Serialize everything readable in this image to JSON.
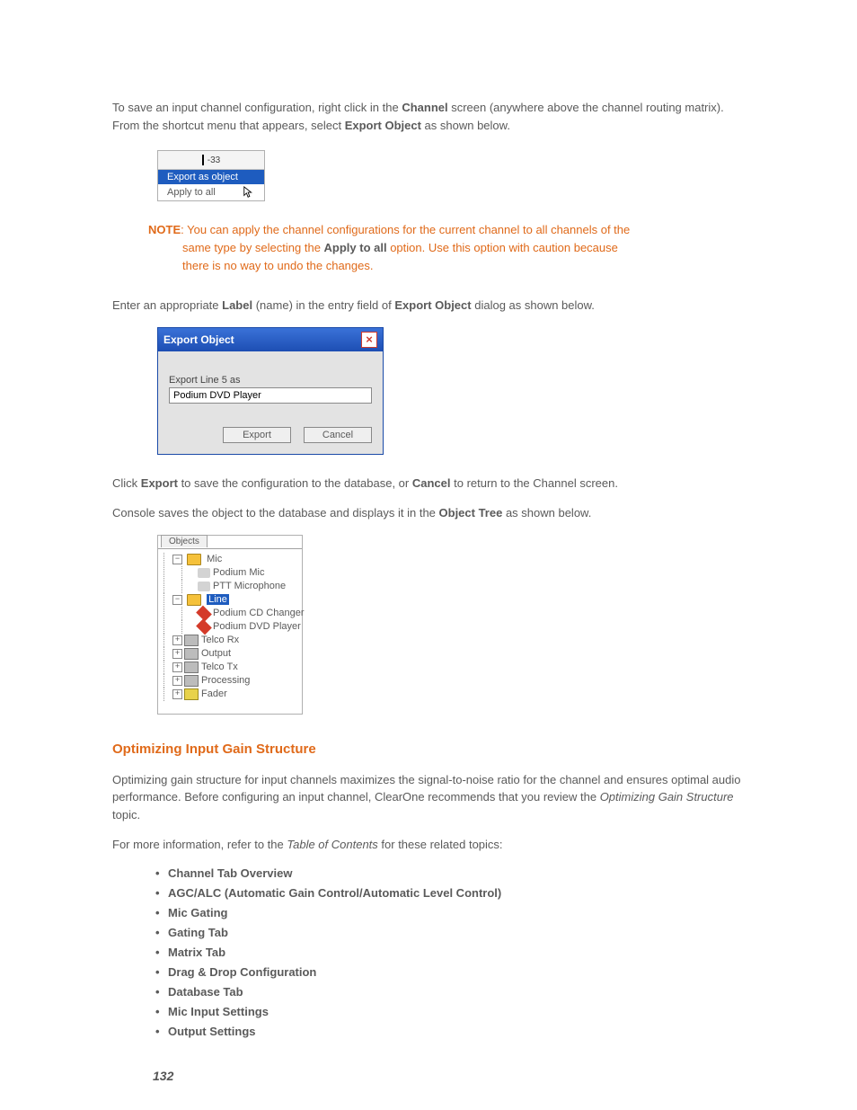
{
  "para1": {
    "pre": "To save an input channel configuration, right click in the ",
    "bold1": "Channel",
    "mid": " screen (anywhere above the channel routing matrix). From the shortcut menu that appears, select ",
    "bold2": "Export Object",
    "post": " as shown below."
  },
  "ctxmenu": {
    "topval": "-33",
    "item1": "Export as object",
    "item2": "Apply to all"
  },
  "note": {
    "label": "NOTE",
    "l1a": ": You can apply the channel configurations for the current channel to all channels of the ",
    "l2a": "same type by selecting the ",
    "l2bold": "Apply to all",
    "l2b": " option. Use this option with caution because ",
    "l3": "there is no way to undo the changes."
  },
  "para2": {
    "pre": "Enter an appropriate ",
    "b1": "Label",
    "mid": " (name) in the entry field of ",
    "b2": "Export Object",
    "post": " dialog as shown below."
  },
  "dialog": {
    "title": "Export Object",
    "label": "Export Line 5 as",
    "value": "Podium DVD Player",
    "export": "Export",
    "cancel": "Cancel"
  },
  "para3": {
    "pre": "Click ",
    "b1": "Export",
    "mid": " to save the configuration to the database, or ",
    "b2": "Cancel",
    "post": " to return to the Channel screen."
  },
  "para4": {
    "pre": "Console saves the object to the database and displays it in the ",
    "b1": "Object Tree",
    "post": " as shown below."
  },
  "tree": {
    "tab": "Objects",
    "mic": "Mic",
    "mic1": "Podium Mic",
    "mic2": "PTT Microphone",
    "line": "Line",
    "line1": "Podium CD Changer",
    "line2": "Podium DVD Player",
    "telcoRx": "Telco Rx",
    "output": "Output",
    "telcoTx": "Telco Tx",
    "processing": "Processing",
    "fader": "Fader"
  },
  "section": "Optimizing Input Gain Structure",
  "para5": {
    "a": "Optimizing gain structure for input channels maximizes the signal-to-noise ratio for the channel and ensures optimal audio performance. Before configuring an input channel, ClearOne recommends that you review the ",
    "i": "Optimizing Gain Structure",
    "b": " topic."
  },
  "para6": {
    "a": "For more information, refer to the ",
    "i": "Table of Contents",
    "b": " for these related topics:"
  },
  "topics": [
    "Channel Tab Overview",
    "AGC/ALC (Automatic Gain Control/Automatic Level Control)",
    "Mic Gating",
    "Gating Tab",
    "Matrix Tab",
    "Drag & Drop Configuration",
    "Database Tab",
    "Mic Input Settings",
    "Output Settings"
  ],
  "pagenum": "132"
}
